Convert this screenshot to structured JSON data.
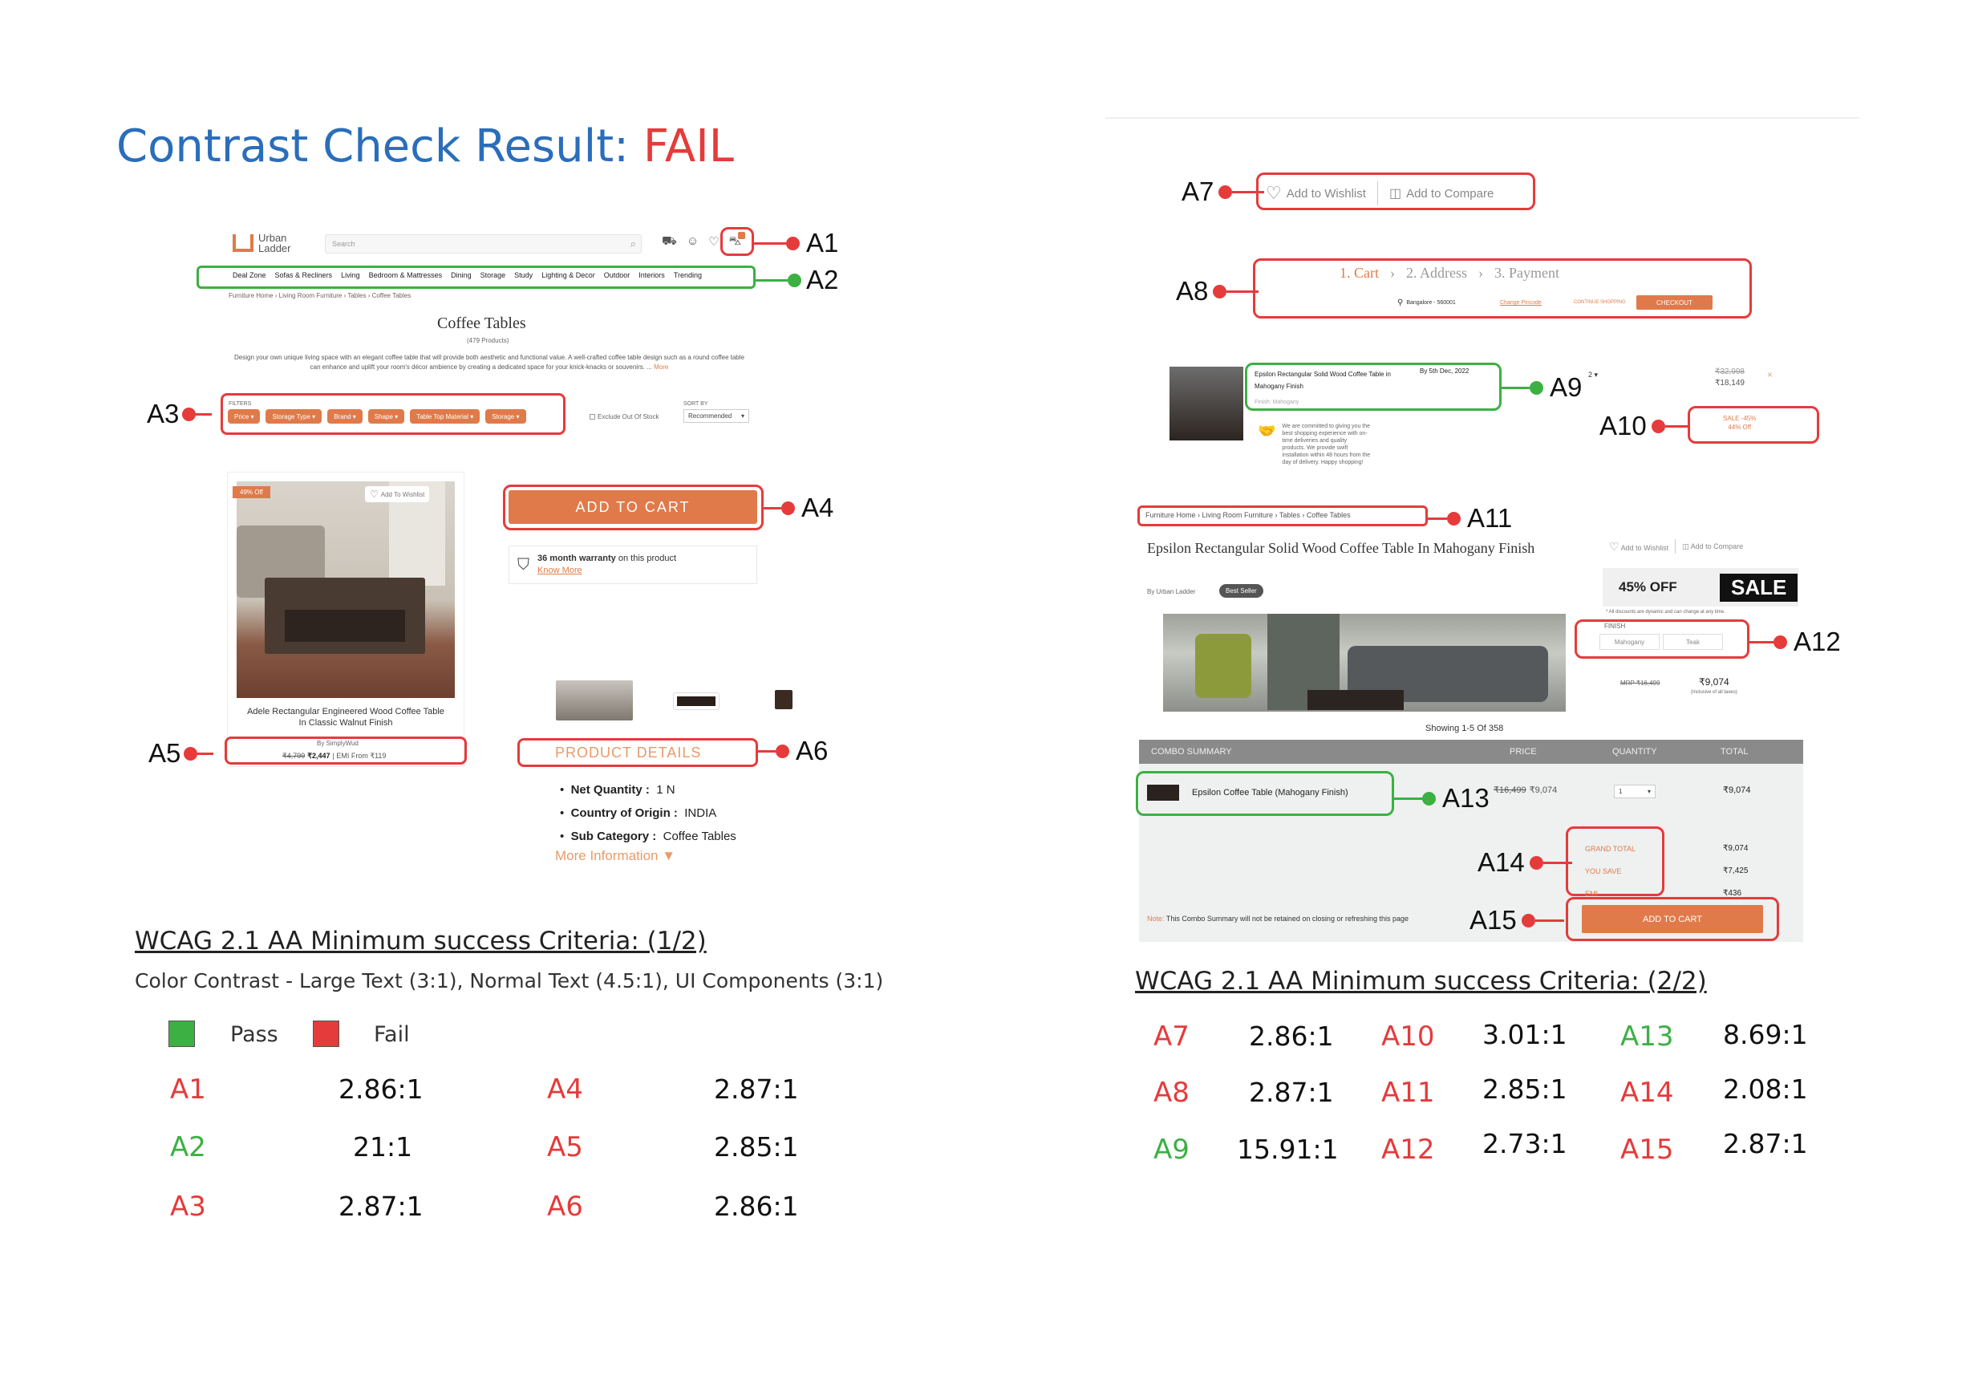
{
  "title": {
    "prefix": "Contrast Check Result: ",
    "status": "FAIL"
  },
  "colors": {
    "accent_blue": "#2a6ebb",
    "fail_red": "#e53b3b",
    "pass_green": "#3cb043",
    "brand_orange": "#e07a4a"
  },
  "left_shot": {
    "logo_line1": "Urban",
    "logo_line2": "Ladder",
    "search_placeholder": "Search",
    "nav_items": [
      "Deal Zone",
      "Sofas & Recliners",
      "Living",
      "Bedroom & Mattresses",
      "Dining",
      "Storage",
      "Study",
      "Lighting & Decor",
      "Outdoor",
      "Interiors",
      "Trending"
    ],
    "breadcrumb": "Furniture Home › Living Room Furniture › Tables › Coffee Tables",
    "page_title": "Coffee Tables",
    "product_count": "(479 Products)",
    "description": "Design your own unique living space with an elegant coffee table that will provide both aesthetic and functional value. A well-crafted coffee table design such as a round coffee table can enhance and uplift your room's décor ambience by creating a dedicated space for your knick-knacks or souvenirs. ...",
    "description_more": "More",
    "filters_label": "FILTERS",
    "filters": [
      "Price",
      "Storage Type",
      "Brand",
      "Shape",
      "Table Top Material",
      "Storage"
    ],
    "exclude_label": "Exclude Out Of Stock",
    "sort_label": "SORT BY",
    "sort_value": "Recommended",
    "badge_off": "49% Off",
    "add_to_wishlist": "Add To Wishlist",
    "product_name": "Adele Rectangular Engineered Wood Coffee Table In Classic Walnut Finish",
    "product_brand": "By SimplyWud",
    "price_old": "₹4,799",
    "price_new": "₹2,447",
    "price_emi": "| EMI From ₹119",
    "add_to_cart": "ADD TO CART",
    "warranty_bold": "36 month warranty",
    "warranty_rest": " on this product",
    "know_more": "Know More",
    "product_details": "PRODUCT DETAILS",
    "details": [
      {
        "k": "Net Quantity :",
        "v": "1 N"
      },
      {
        "k": "Country of Origin :",
        "v": "INDIA"
      },
      {
        "k": "Sub Category :",
        "v": "Coffee Tables"
      }
    ],
    "more_info": "More Information"
  },
  "right_shot": {
    "wishlist": "Add to Wishlist",
    "compare": "Add to Compare",
    "steps": [
      "1. Cart",
      "2. Address",
      "3. Payment"
    ],
    "location": "Bangalore - 560001",
    "change_pincode": "Change Pincode",
    "continue_shopping": "CONTINUE SHOPPING",
    "checkout": "CHECKOUT",
    "cart_item_name": "Epsilon Rectangular Solid Wood Coffee Table in Mahogany Finish",
    "cart_item_date": "By 5th Dec, 2022",
    "cart_item_finish": "Finish: Mahogany",
    "cart_qty": "2",
    "commit_text": "We are committed to giving you the best shopping experience with on-time deliveries and quality products. We provide swift installation within 48 hours from the day of delivery. Happy shopping!",
    "price_strike": "₹32,998",
    "price_now": "₹18,149",
    "sale_line1": "SALE -45%",
    "sale_line2": "44% Off",
    "breadcrumb": "Furniture Home › Living Room Furniture › Tables › Coffee Tables",
    "pdp_title": "Epsilon Rectangular Solid Wood Coffee Table In Mahogany Finish",
    "by_brand": "By Urban Ladder",
    "best_seller": "Best Seller",
    "pdp_wishlist": "Add to Wishlist",
    "pdp_compare": "Add to Compare",
    "off_text": "45% OFF",
    "sale_text": "SALE",
    "discount_note": "* All discounts are dynamic and can change at any time.",
    "finish_label": "FINISH",
    "finish_options": [
      "Mahogany",
      "Teak"
    ],
    "mrp": "MRP ₹16,499",
    "pdp_price": "₹9,074",
    "inclusive": "(Inclusive of all taxes)",
    "showing": "Showing 1-5 Of 358",
    "combo_headers": [
      "COMBO SUMMARY",
      "PRICE",
      "QUANTITY",
      "TOTAL"
    ],
    "combo_item": "Epsilon Coffee Table (Mahogany Finish)",
    "combo_old": "₹16,499",
    "combo_new": "₹9,074",
    "combo_qty": "1",
    "combo_total": "₹9,074",
    "summary": [
      {
        "k": "GRAND TOTAL",
        "v": "₹9,074"
      },
      {
        "k": "YOU SAVE",
        "v": "₹7,425"
      },
      {
        "k": "EMI",
        "v": "₹436"
      }
    ],
    "note_label": "Note:",
    "note_text": " This Combo Summary will not be retained on closing or refreshing this page",
    "combo_add": "ADD TO CART"
  },
  "annotations": {
    "A1": "A1",
    "A2": "A2",
    "A3": "A3",
    "A4": "A4",
    "A5": "A5",
    "A6": "A6",
    "A7": "A7",
    "A8": "A8",
    "A9": "A9",
    "A10": "A10",
    "A11": "A11",
    "A12": "A12",
    "A13": "A13",
    "A14": "A14",
    "A15": "A15"
  },
  "criteria1": {
    "heading": "WCAG 2.1 AA Minimum success Criteria: (1/2)",
    "subheading": "Color Contrast - Large Text (3:1), Normal Text (4.5:1), UI Components (3:1)",
    "legend_pass": "Pass",
    "legend_fail": "Fail",
    "results": [
      {
        "id": "A1",
        "ratio": "2.86:1",
        "status": "fail"
      },
      {
        "id": "A2",
        "ratio": "21:1",
        "status": "pass"
      },
      {
        "id": "A3",
        "ratio": "2.87:1",
        "status": "fail"
      },
      {
        "id": "A4",
        "ratio": "2.87:1",
        "status": "fail"
      },
      {
        "id": "A5",
        "ratio": "2.85:1",
        "status": "fail"
      },
      {
        "id": "A6",
        "ratio": "2.86:1",
        "status": "fail"
      }
    ]
  },
  "criteria2": {
    "heading": "WCAG 2.1 AA Minimum success Criteria: (2/2)",
    "results": [
      {
        "id": "A7",
        "ratio": "2.86:1",
        "status": "fail"
      },
      {
        "id": "A8",
        "ratio": "2.87:1",
        "status": "fail"
      },
      {
        "id": "A9",
        "ratio": "15.91:1",
        "status": "pass"
      },
      {
        "id": "A10",
        "ratio": "3.01:1",
        "status": "fail"
      },
      {
        "id": "A11",
        "ratio": "2.85:1",
        "status": "fail"
      },
      {
        "id": "A12",
        "ratio": "2.73:1",
        "status": "fail"
      },
      {
        "id": "A13",
        "ratio": "8.69:1",
        "status": "pass"
      },
      {
        "id": "A14",
        "ratio": "2.08:1",
        "status": "fail"
      },
      {
        "id": "A15",
        "ratio": "2.87:1",
        "status": "fail"
      }
    ]
  }
}
